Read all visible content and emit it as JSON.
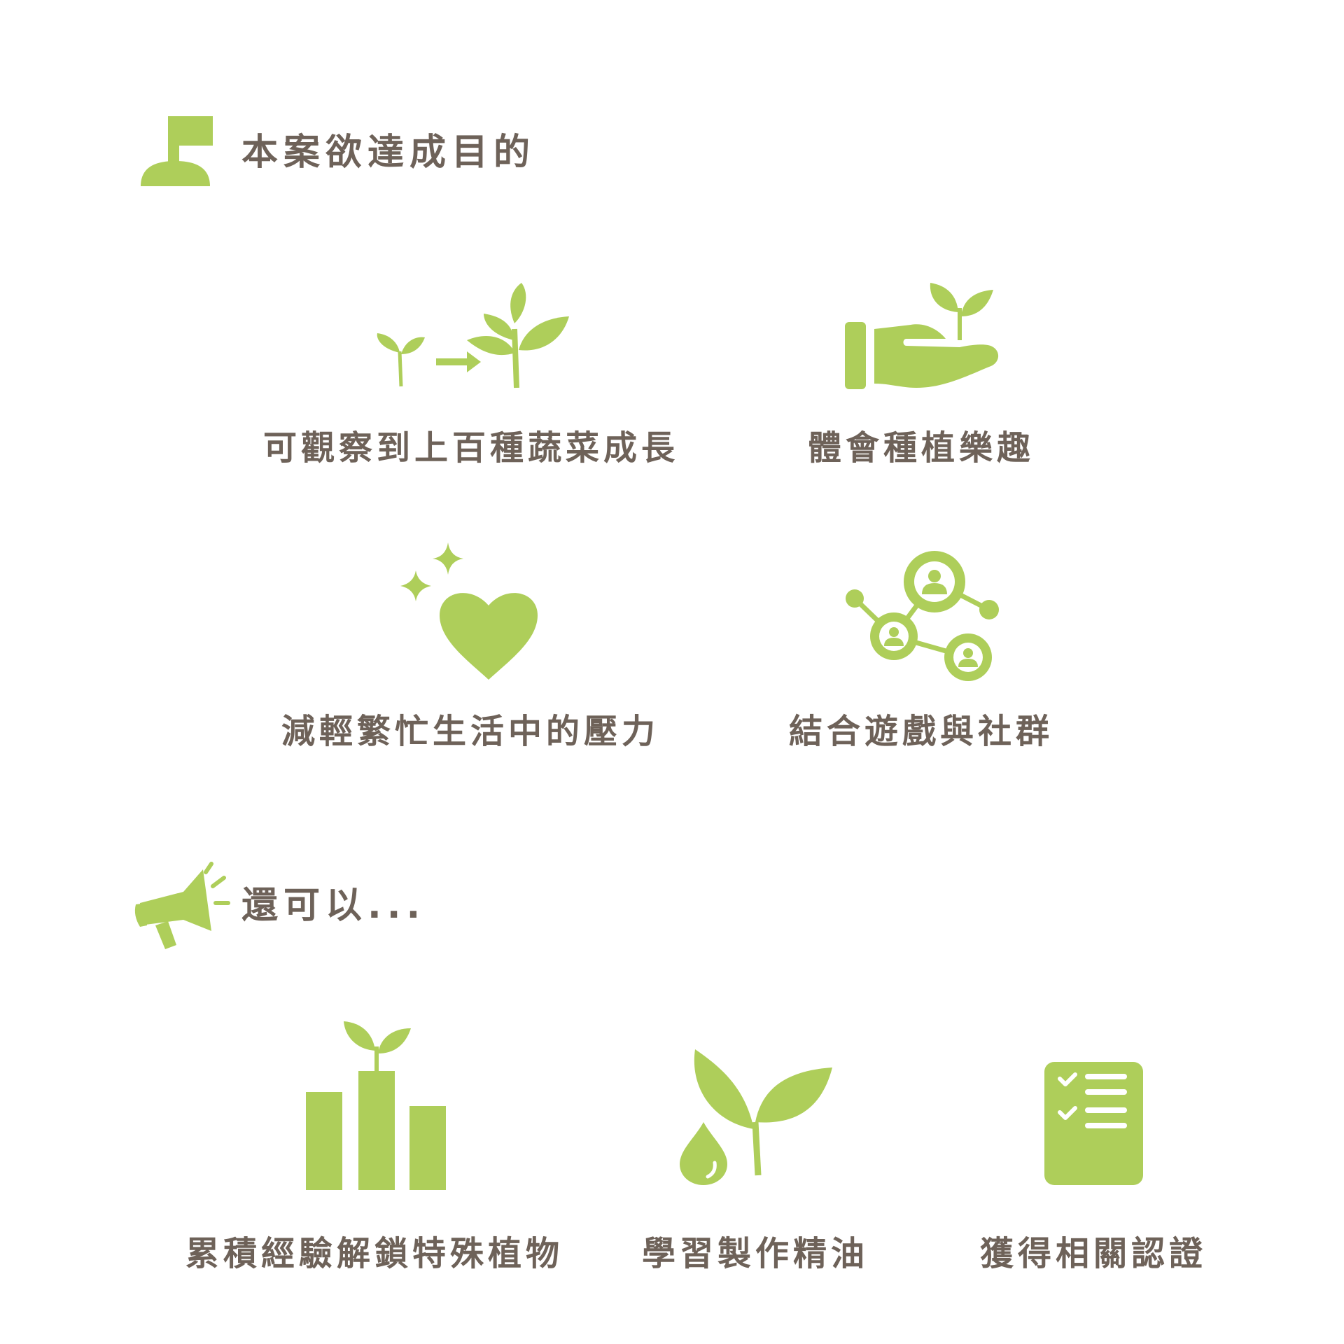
{
  "accent_color": "#aece5a",
  "text_color": "#6e6259",
  "section1": {
    "heading": "本案欲達成目的",
    "icon": "flag-icon",
    "items": [
      {
        "icon": "seedling-growth-icon",
        "label": "可觀察到上百種蔬菜成長"
      },
      {
        "icon": "hand-holding-plant-icon",
        "label": "體會種植樂趣"
      },
      {
        "icon": "sparkle-heart-icon",
        "label": "減輕繁忙生活中的壓力"
      },
      {
        "icon": "social-network-icon",
        "label": "結合遊戲與社群"
      }
    ]
  },
  "section2": {
    "heading": "還可以...",
    "icon": "megaphone-icon",
    "items": [
      {
        "icon": "bar-chart-plant-icon",
        "label": "累積經驗解鎖特殊植物"
      },
      {
        "icon": "plant-oil-drop-icon",
        "label": "學習製作精油"
      },
      {
        "icon": "checklist-document-icon",
        "label": "獲得相關認證"
      }
    ]
  }
}
